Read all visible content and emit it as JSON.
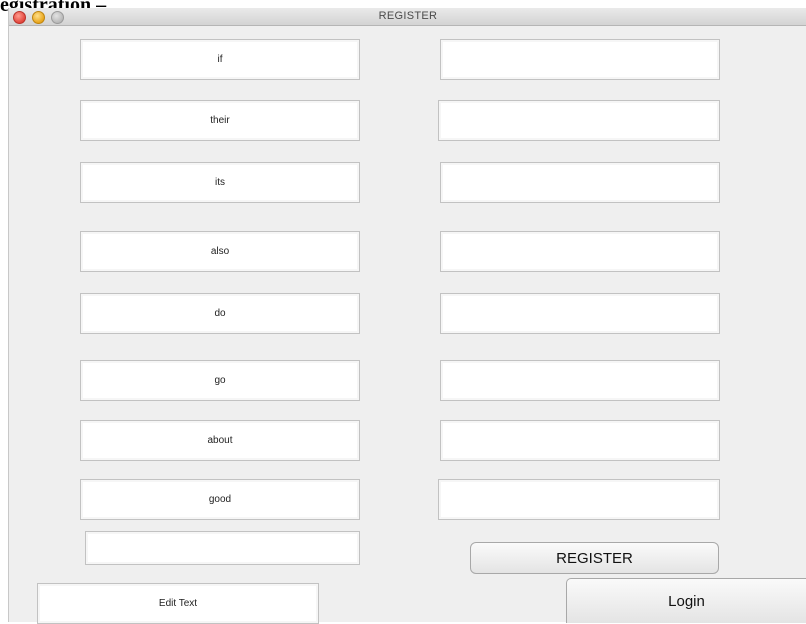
{
  "caption": "egistration –",
  "window": {
    "title": "REGISTER"
  },
  "left_fields": [
    "if",
    "their",
    "its",
    "also",
    "do",
    "go",
    "about",
    "good",
    ""
  ],
  "right_fields": [
    "",
    "",
    "",
    "",
    "",
    "",
    "",
    ""
  ],
  "register_button": "REGISTER",
  "edit_text": "Edit Text",
  "login_button": "Login"
}
